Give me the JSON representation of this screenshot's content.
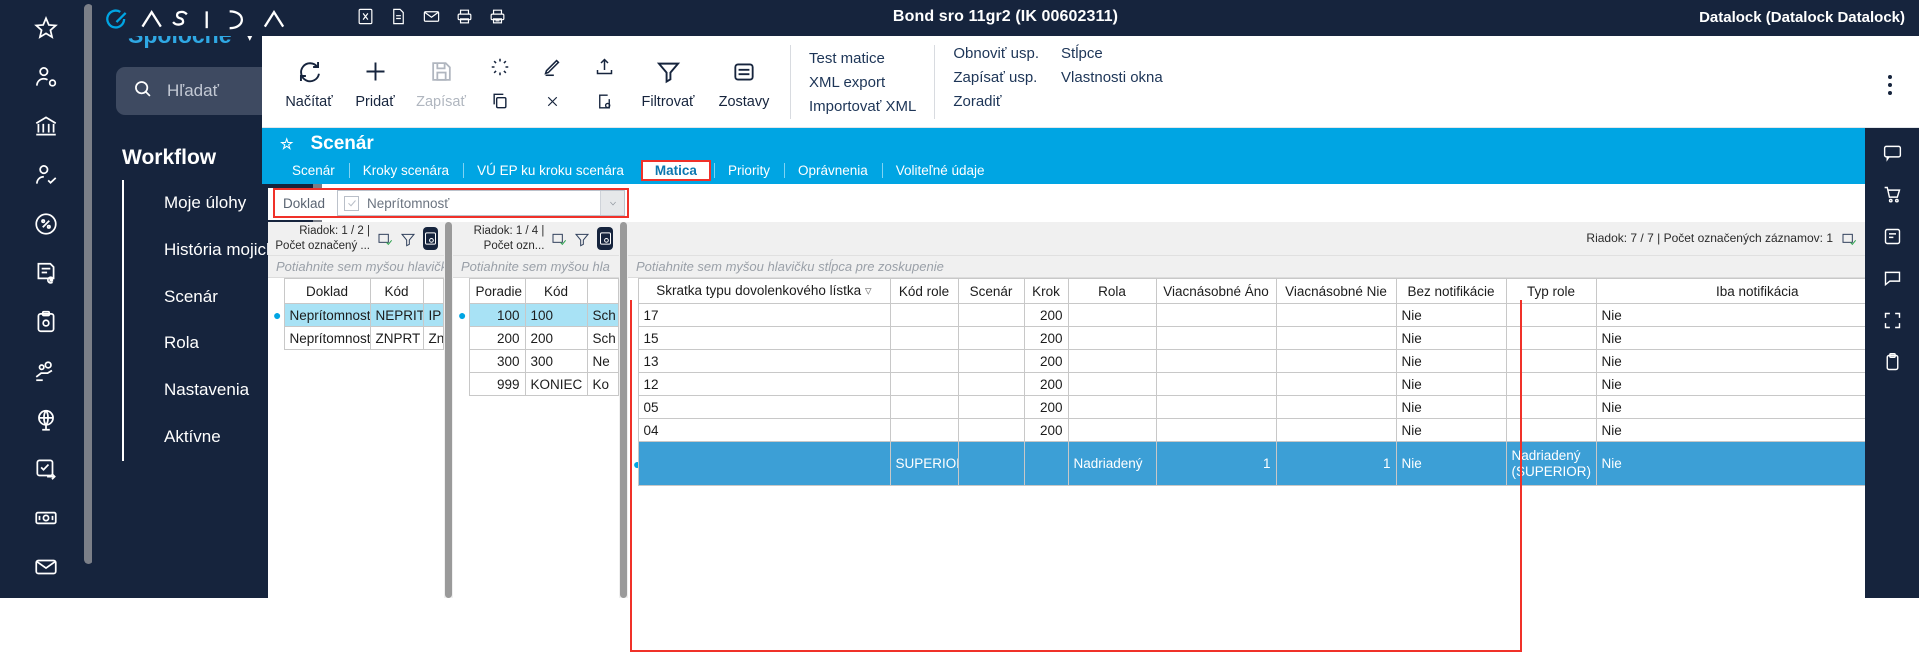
{
  "topbar": {
    "brand_letters": "QASIDA",
    "title": "Bond sro 11gr2 (IK 00602311)",
    "user": "Datalock (Datalock Datalock)",
    "doc_icons": [
      "excel-icon",
      "document-icon",
      "mail-icon",
      "print-icon",
      "print-preview-icon"
    ]
  },
  "sidebar": {
    "section_title": "Spoločné",
    "search_placeholder": "Hľadať",
    "group_title": "Workflow",
    "items": [
      {
        "label": "Moje úlohy"
      },
      {
        "label": "História mojich úloh"
      },
      {
        "label": "Scenár"
      },
      {
        "label": "Rola"
      },
      {
        "label": "Nastavenia"
      },
      {
        "label": "Aktívne"
      }
    ],
    "rail_icons": [
      "star-icon",
      "user-settings-icon",
      "bank-icon",
      "user-check-icon",
      "percent-circle-icon",
      "invoice-euro-icon",
      "clipboard-icon",
      "handshake-icon",
      "globe-icon",
      "task-transfer-icon",
      "cash-icon",
      "mail-icon"
    ]
  },
  "toolbar": {
    "buttons": [
      {
        "label": "Načítať",
        "icon": "refresh-icon",
        "disabled": false
      },
      {
        "label": "Pridať",
        "icon": "plus-icon",
        "disabled": false
      },
      {
        "label": "Zapísať",
        "icon": "save-icon",
        "disabled": true
      },
      {
        "label": "",
        "icon": "spinner-icon",
        "disabled": false
      },
      {
        "label": "",
        "icon": "pencil-icon",
        "disabled": false
      },
      {
        "label": "",
        "icon": "upload-icon",
        "disabled": false
      },
      {
        "label": "",
        "icon": "copy-icon",
        "disabled": false
      },
      {
        "label": "",
        "icon": "close-x-icon",
        "disabled": false
      },
      {
        "label": "",
        "icon": "document-search-icon",
        "disabled": false
      },
      {
        "label": "Filtrovať",
        "icon": "filter-icon",
        "disabled": false
      },
      {
        "label": "Zostavy",
        "icon": "reports-icon",
        "disabled": false
      }
    ],
    "menu_col1": [
      "Test matice",
      "XML export",
      "Importovať XML"
    ],
    "menu_col2": [
      "Obnoviť usp.",
      "Zapísať usp.",
      "Zoradiť"
    ],
    "menu_col3": [
      "Stĺpce",
      "Vlastnosti okna"
    ],
    "overflow": "kebab-menu-icon"
  },
  "page": {
    "title": "Scenár",
    "tabs": [
      {
        "label": "Scenár",
        "active": false
      },
      {
        "label": "Kroky scenára",
        "active": false
      },
      {
        "label": "VÚ EP ku kroku scenára",
        "active": false
      },
      {
        "label": "Matica",
        "active": true
      },
      {
        "label": "Priority",
        "active": false
      },
      {
        "label": "Oprávnenia",
        "active": false
      },
      {
        "label": "Voliteľné údaje",
        "active": false
      }
    ]
  },
  "filter": {
    "label": "Doklad",
    "value": "Neprítomnosť",
    "checkbox_checked": true
  },
  "grid1": {
    "status": "Riadok: 1 / 2 | Počet označený ...",
    "group_hint": "Potiahnite sem myšou hlavičku stĺpca pre zoskupenie",
    "columns": [
      "Doklad",
      "Kód",
      ""
    ],
    "rows": [
      {
        "selected": true,
        "cells": [
          "Neprítomnosť",
          "NEPRIT",
          "IP"
        ]
      },
      {
        "selected": false,
        "cells": [
          "Neprítomnosť",
          "ZNPRT",
          "Zn"
        ]
      }
    ]
  },
  "grid2": {
    "status": "Riadok: 1 / 4 | Počet ozn...",
    "group_hint": "Potiahnite sem myšou hla",
    "columns": [
      "Poradie",
      "Kód",
      ""
    ],
    "rows": [
      {
        "selected": true,
        "cells": [
          "100",
          "100",
          "Sch"
        ]
      },
      {
        "selected": false,
        "cells": [
          "200",
          "200",
          "Sch"
        ]
      },
      {
        "selected": false,
        "cells": [
          "300",
          "300",
          "Ne"
        ]
      },
      {
        "selected": false,
        "cells": [
          "999",
          "KONIEC",
          "Ko"
        ]
      }
    ]
  },
  "grid3": {
    "status": "Riadok: 7 / 7 | Počet označených záznamov: 1",
    "group_hint": "Potiahnite sem myšou hlavičku stĺpca pre zoskupenie",
    "columns": [
      "Skratka typu dovolenkového lístka",
      "Kód role",
      "Scenár",
      "Krok",
      "Rola",
      "Viacnásobné Áno",
      "Viacnásobné Nie",
      "Bez notifikácie",
      "Typ role",
      "Iba notifikácia"
    ],
    "sorted_column": "Skratka typu dovolenkového lístka",
    "rows": [
      {
        "highlight": false,
        "cells": [
          "17",
          "",
          "",
          "200",
          "",
          "",
          "",
          "Nie",
          "",
          "Nie"
        ]
      },
      {
        "highlight": false,
        "cells": [
          "15",
          "",
          "",
          "200",
          "",
          "",
          "",
          "Nie",
          "",
          "Nie"
        ]
      },
      {
        "highlight": false,
        "cells": [
          "13",
          "",
          "",
          "200",
          "",
          "",
          "",
          "Nie",
          "",
          "Nie"
        ]
      },
      {
        "highlight": false,
        "cells": [
          "12",
          "",
          "",
          "200",
          "",
          "",
          "",
          "Nie",
          "",
          "Nie"
        ]
      },
      {
        "highlight": false,
        "cells": [
          "05",
          "",
          "",
          "200",
          "",
          "",
          "",
          "Nie",
          "",
          "Nie"
        ]
      },
      {
        "highlight": false,
        "cells": [
          "04",
          "",
          "",
          "200",
          "",
          "",
          "",
          "Nie",
          "",
          "Nie"
        ]
      },
      {
        "highlight": true,
        "cells": [
          "",
          "SUPERIOR",
          "",
          "",
          "Nadriadený",
          "1",
          "1",
          "Nie",
          "Nadriadený (SUPERIOR)",
          "Nie"
        ]
      }
    ]
  },
  "colors": {
    "navy": "#16243d",
    "cyan": "#00a5e3",
    "accent_red": "#f03129",
    "row_select": "#a8e2f5",
    "row_blue": "#3c9fd6"
  }
}
